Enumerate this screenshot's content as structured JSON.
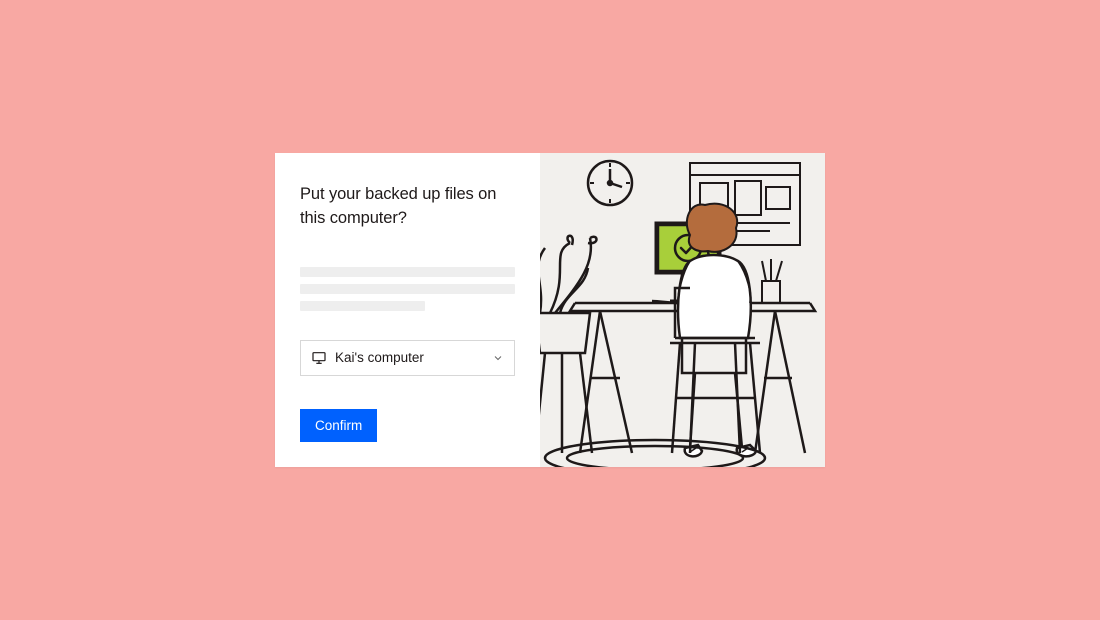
{
  "dialog": {
    "title": "Put your backed up files on this computer?",
    "select": {
      "value": "Kai's computer"
    },
    "confirm_label": "Confirm"
  },
  "colors": {
    "page_bg": "#f8a8a3",
    "accent": "#0061fe",
    "illustration_bg": "#f2f0ed",
    "screen_green": "#a8cf3a",
    "hair_brown": "#b46c3d"
  }
}
